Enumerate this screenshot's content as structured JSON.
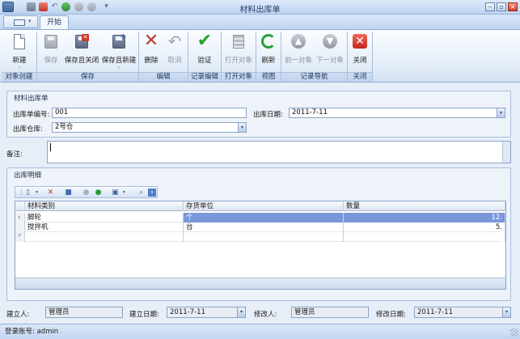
{
  "window": {
    "title": "材料出库单"
  },
  "quick_access": {
    "more": "▾"
  },
  "ribbon": {
    "active_tab": "开始",
    "groups": {
      "create": {
        "label": "对象创建",
        "new": "新建"
      },
      "save": {
        "label": "保存",
        "save": "保存",
        "save_close": "保存且关闭",
        "save_new": "保存且新建"
      },
      "edit": {
        "label": "编辑",
        "delete": "删除",
        "cancel": "取消"
      },
      "record_edit": {
        "label": "记录编辑",
        "verify": "验证"
      },
      "open": {
        "label": "打开对象",
        "open_obj": "打开对象"
      },
      "view": {
        "label": "视图",
        "refresh": "刷新"
      },
      "nav": {
        "label": "记录导航",
        "prev": "前一对象",
        "next": "下一对象"
      },
      "close": {
        "label": "关闭",
        "close": "关闭"
      }
    }
  },
  "header": {
    "section_title": "材料出库单",
    "no_label": "出库单编号:",
    "no_value": "001",
    "date_label": "出库日期:",
    "date_value": "2011-7-11",
    "warehouse_label": "出库仓库:",
    "warehouse_value": "2号仓",
    "remark_label": "备注:"
  },
  "detail": {
    "section_title": "出库明细",
    "columns": [
      "材料类别",
      "存货单位",
      "数量"
    ],
    "rows": [
      {
        "category": "脚轮",
        "unit": "个",
        "qty": "12."
      },
      {
        "category": "搅拌机",
        "unit": "台",
        "qty": "5."
      }
    ],
    "row_markers": {
      "selected": "›",
      "new": "*"
    }
  },
  "footer": {
    "creator_label": "建立人:",
    "creator_value": "管理员",
    "created_label": "建立日期:",
    "created_value": "2011-7-11",
    "modifier_label": "修改人:",
    "modifier_value": "管理员",
    "modified_label": "修改日期:",
    "modified_value": "2011-7-11"
  },
  "status": {
    "login": "登录账号: admin"
  }
}
